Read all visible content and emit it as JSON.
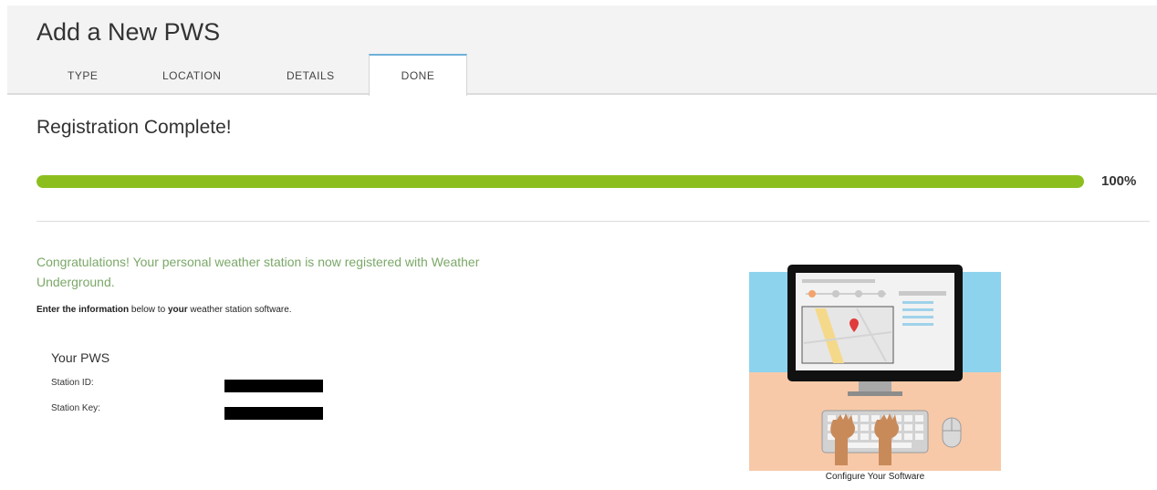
{
  "header": {
    "title": "Add a New PWS",
    "tabs": [
      {
        "label": "TYPE"
      },
      {
        "label": "LOCATION"
      },
      {
        "label": "DETAILS"
      },
      {
        "label": "DONE",
        "active": true
      }
    ]
  },
  "main": {
    "title": "Registration Complete!",
    "progress": {
      "percent": 100,
      "label": "100%",
      "fill_color": "#8cbf1e"
    },
    "congrats_text": "Congratulations! Your personal weather station is now registered with Weather Underground.",
    "instructions": {
      "part1": "Enter the information",
      "part2": " below to ",
      "part3": "your",
      "part4": " weather station software."
    },
    "pws": {
      "heading": "Your PWS",
      "station_id_label": "Station ID:",
      "station_key_label": "Station Key:"
    },
    "illustration": {
      "caption": "Configure Your Software",
      "colors": {
        "sky": "#8ed3ee",
        "desk": "#f7c9a8",
        "pin": "#e03a3a"
      }
    }
  }
}
